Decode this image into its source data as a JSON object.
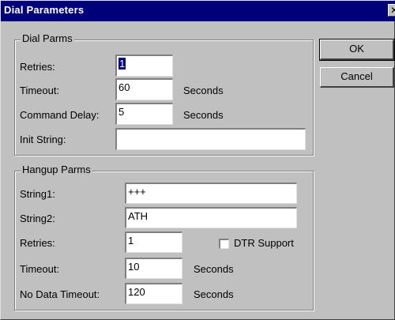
{
  "window": {
    "title": "Dial Parameters",
    "close_glyph": "✕"
  },
  "buttons": {
    "ok": "OK",
    "cancel": "Cancel"
  },
  "dial_parms": {
    "legend": "Dial Parms",
    "retries": {
      "label": "Retries:",
      "value": "1"
    },
    "timeout": {
      "label": "Timeout:",
      "value": "60",
      "unit": "Seconds"
    },
    "command_delay": {
      "label": "Command Delay:",
      "value": "5",
      "unit": "Seconds"
    },
    "init_string": {
      "label": "Init String:",
      "value": ""
    }
  },
  "hangup_parms": {
    "legend": "Hangup Parms",
    "string1": {
      "label": "String1:",
      "value": "+++"
    },
    "string2": {
      "label": "String2:",
      "value": "ATH"
    },
    "retries": {
      "label": "Retries:",
      "value": "1"
    },
    "dtr_support": {
      "label": "DTR Support",
      "checked": false
    },
    "timeout": {
      "label": "Timeout:",
      "value": "10",
      "unit": "Seconds"
    },
    "no_data_timeout": {
      "label": "No Data Timeout:",
      "value": "120",
      "unit": "Seconds"
    }
  }
}
